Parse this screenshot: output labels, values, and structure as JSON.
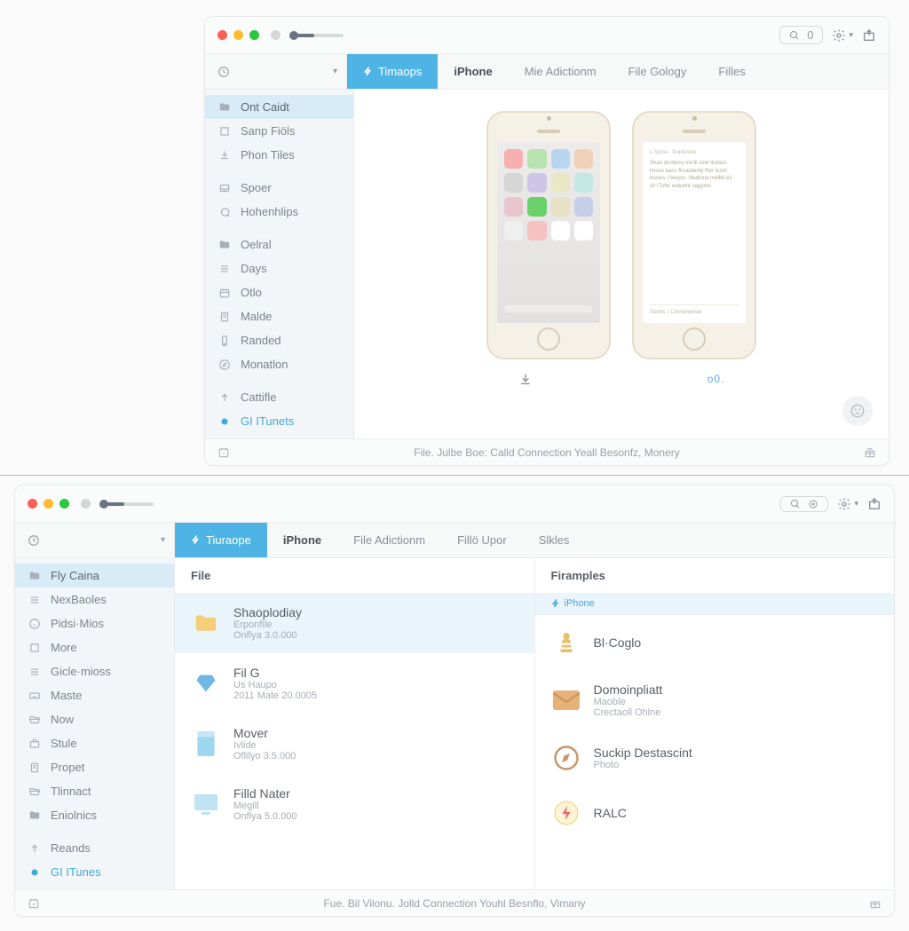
{
  "windowA": {
    "tabs": [
      "Timaops",
      "iPhone",
      "Mie Adictionm",
      "File Gology",
      "Filles"
    ],
    "sidebar": [
      {
        "icon": "folder",
        "label": "Ont Caidt",
        "sel": true
      },
      {
        "icon": "square",
        "label": "Sanp Fiöls"
      },
      {
        "icon": "download-alt",
        "label": "Phon Tiles"
      },
      {
        "icon": "inbox",
        "label": "Spoer",
        "gap": true
      },
      {
        "icon": "chat",
        "label": "Hohenhlips"
      },
      {
        "icon": "folder",
        "label": "Oelral",
        "gap": true
      },
      {
        "icon": "lines",
        "label": "Days"
      },
      {
        "icon": "calendar",
        "label": "Otlo"
      },
      {
        "icon": "note",
        "label": "Malde"
      },
      {
        "icon": "phone",
        "label": "Randed"
      },
      {
        "icon": "compass",
        "label": "Monatlon"
      },
      {
        "icon": "uparrow",
        "label": "Cattifle",
        "gap": true
      },
      {
        "icon": "dotblue",
        "label": "GI  ITunets",
        "blue": true
      }
    ],
    "search_zero": "0",
    "action_right": "ᴏ0.",
    "noteHeader": "s Syme · Duntusine",
    "noteBody": "Shan dunbuny evl ill sme itorlars lmose bans fhsardenty fhvr iruvrl busios i fwsysn. Ilbattsna melbd e1 sh iTufer watuent nagyme.",
    "noteFooter": "Sowtd. t  Cnimenyesie",
    "status": "File.  Julbe  Boe:  Calld  Connection   Yeall  Besonfz, Monery"
  },
  "windowB": {
    "tabs": [
      "Tiuraope",
      "iPhone",
      "File Adictionm",
      "Fillö Upor",
      "Slkles"
    ],
    "sidebar": [
      {
        "icon": "folder",
        "label": "Fly Caina",
        "sel": true
      },
      {
        "icon": "lines",
        "label": "NexBaoles"
      },
      {
        "icon": "info",
        "label": "Pidsi·Mios"
      },
      {
        "icon": "square",
        "label": "More"
      },
      {
        "icon": "lines",
        "label": "Gicle·mioss"
      },
      {
        "icon": "keyboard",
        "label": "Maste"
      },
      {
        "icon": "folderopen",
        "label": "Now"
      },
      {
        "icon": "briefcase",
        "label": "Stule"
      },
      {
        "icon": "note",
        "label": "Propet"
      },
      {
        "icon": "folderopen",
        "label": "Tlinnact"
      },
      {
        "icon": "folder",
        "label": "Eniolnics"
      },
      {
        "icon": "uparrow",
        "label": "Reands",
        "gap": true
      },
      {
        "icon": "dotblue",
        "label": "GI  ITunes",
        "blue": true
      }
    ],
    "colLeftHeader": "File",
    "colRightHeader": "Firamples",
    "iphoneChip": "iPhone",
    "leftItems": [
      {
        "icon": "folder-y",
        "title": "Shaoplodiay",
        "sub1": "Erponfile",
        "sub2": "Onflya 3.0.000",
        "sel": true
      },
      {
        "icon": "gem",
        "title": "Fil G",
        "sub1": "Us Haupo",
        "sub2": "2011 Mate 20.0005"
      },
      {
        "icon": "doc",
        "title": "Mover",
        "sub1": "Ivlide",
        "sub2": "Oflilyo 3.5.000"
      },
      {
        "icon": "screen",
        "title": "Filld Nater",
        "sub1": "Megill",
        "sub2": "Onflya 5.0.000"
      }
    ],
    "rightItems": [
      {
        "icon": "pawn",
        "title": "Bl·Coglo",
        "sub1": "",
        "sub2": ""
      },
      {
        "icon": "mail",
        "title": "Domoinpliatt",
        "sub1": "Maoble",
        "sub2": "Crectaoll Ohlne"
      },
      {
        "icon": "compass-o",
        "title": "Suckip Destascint",
        "sub1": "Photo",
        "sub2": ""
      },
      {
        "icon": "bolt",
        "title": "RALC",
        "sub1": "",
        "sub2": ""
      }
    ],
    "status": "Fue.  Bil  Vilonu.  Jolld  Connection   Youhl  Besnflo, Vimany"
  }
}
